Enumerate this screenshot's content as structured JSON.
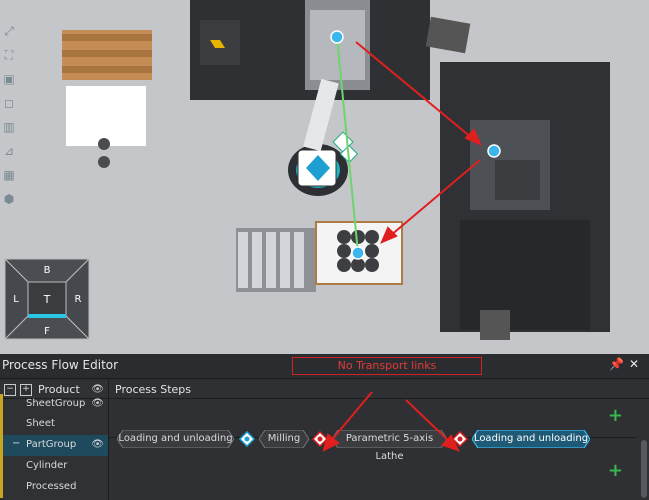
{
  "panel": {
    "title": "Process Flow Editor",
    "warning": "No Transport links",
    "pin_icon": "pin-icon",
    "close_icon": "close-icon"
  },
  "tree": {
    "root": "Product",
    "items": [
      {
        "label": "SheetGroup"
      },
      {
        "label": "Sheet"
      },
      {
        "label": "PartGroup"
      },
      {
        "label": "Cylinder"
      },
      {
        "label": "Processed"
      }
    ]
  },
  "steps": {
    "header": "Process Steps",
    "flow": [
      {
        "label": "Loading and unloading"
      },
      {
        "label": "Milling"
      },
      {
        "label": "Parametric 5-axis Lathe"
      },
      {
        "label": "Loading and unloading"
      }
    ]
  },
  "nav_cube": {
    "top": "B",
    "left": "L",
    "center": "T",
    "right": "R",
    "bottom": "F"
  },
  "colors": {
    "accent": "#1e9fd1",
    "selected_row": "#1e4a5e",
    "warning": "#d21f1f",
    "add": "#36b84a"
  }
}
